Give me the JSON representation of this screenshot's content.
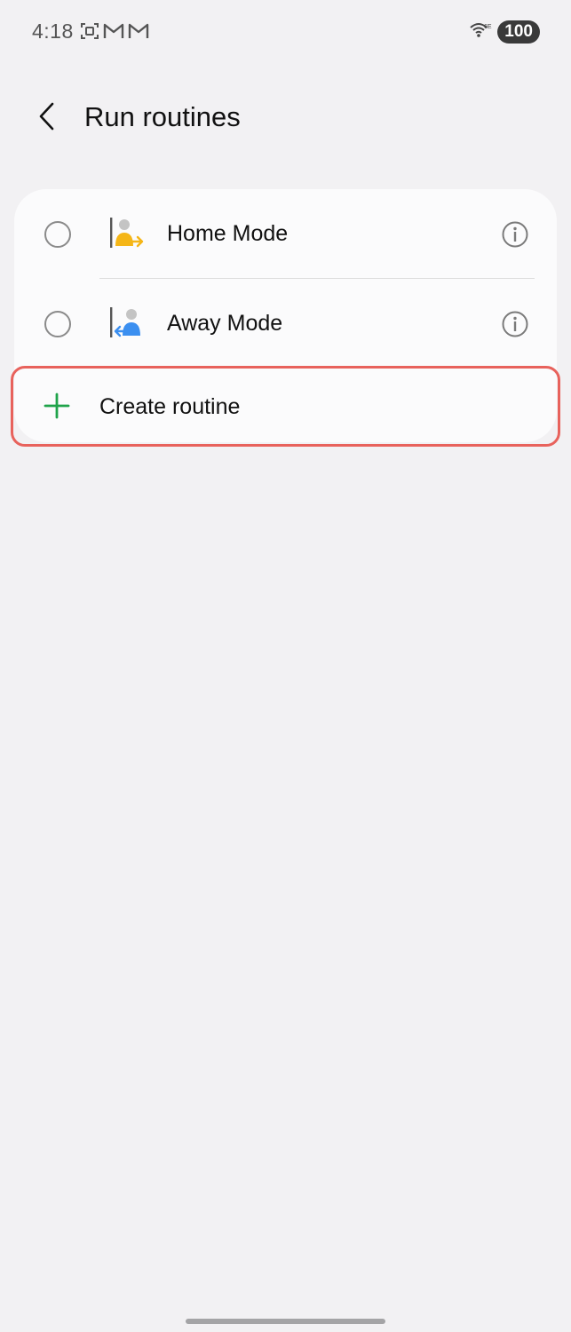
{
  "status_bar": {
    "time": "4:18",
    "battery": "100",
    "icons_left": [
      "screenshot-icon",
      "gmail-icon",
      "gmail-icon"
    ],
    "wifi_label": "6E"
  },
  "header": {
    "title": "Run routines",
    "back_icon": "chevron-left-icon"
  },
  "routines": [
    {
      "label": "Home Mode",
      "icon": "home-mode-icon",
      "accent": "#f5b617",
      "selected": false
    },
    {
      "label": "Away Mode",
      "icon": "away-mode-icon",
      "accent": "#3b8ff0",
      "selected": false
    }
  ],
  "create": {
    "label": "Create routine",
    "icon": "plus-icon",
    "color": "#1fa34a"
  },
  "colors": {
    "background": "#f2f1f3",
    "card": "#fbfbfc",
    "highlight": "#e8625c"
  }
}
